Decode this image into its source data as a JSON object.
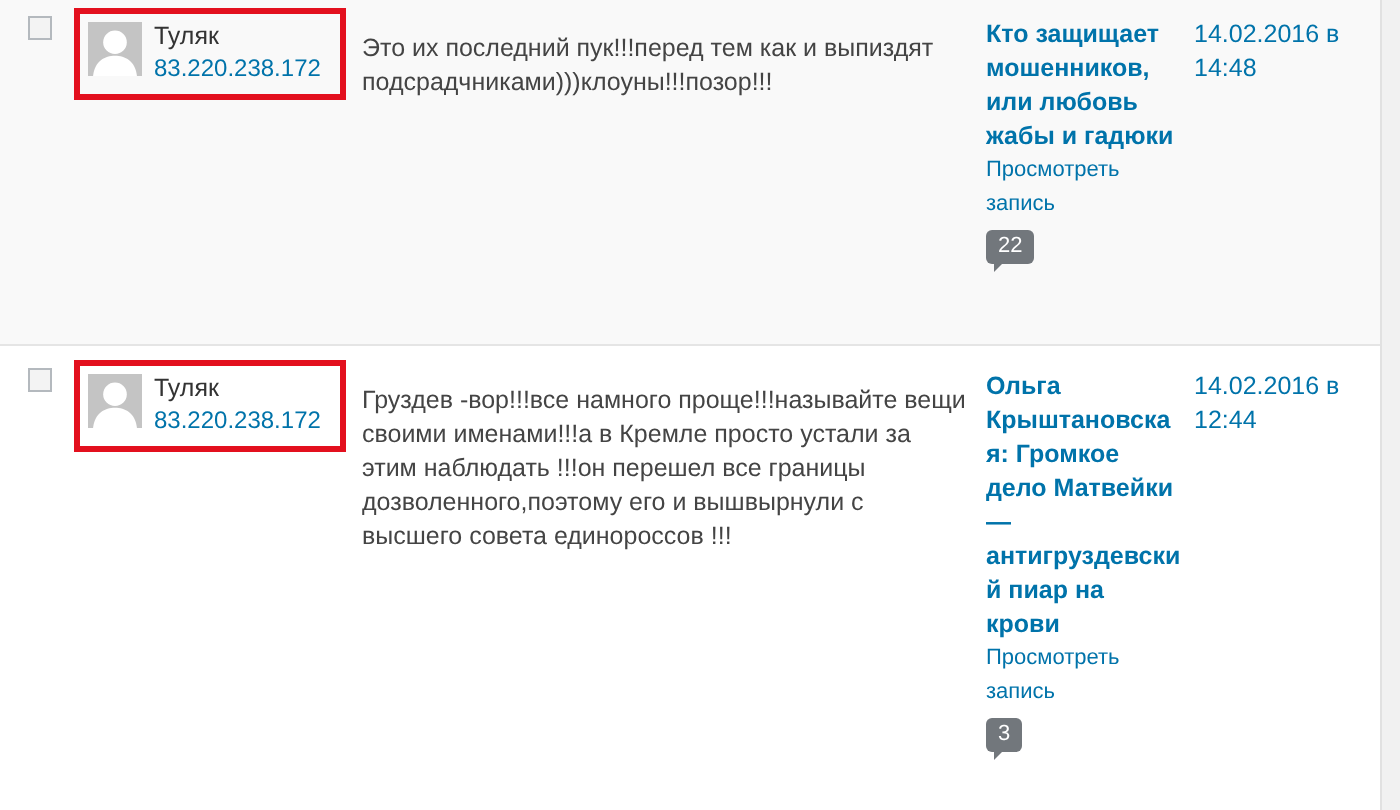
{
  "comments": [
    {
      "shaded": true,
      "checked": false,
      "highlighted": true,
      "author": "Туляк",
      "ip": "83.220.238.172",
      "text": "Это их последний пук!!!перед тем как и выпиздят подсрадчниками)))клоуны!!!позор!!!",
      "post_title": "Кто защищает мошенников, или любовь жабы и гадюки",
      "view_link": "Просмотреть запись",
      "count": "22",
      "date": "14.02.2016 в 14:48"
    },
    {
      "shaded": false,
      "checked": false,
      "highlighted": true,
      "author": "Туляк",
      "ip": "83.220.238.172",
      "text": "Груздев -вор!!!все намного проще!!!называйте вещи своими именами!!!а в Кремле просто устали за этим наблюдать !!!он перешел все границы дозволенного,поэтому его и вышвырнули с высшего совета единороссов !!!",
      "post_title": "Ольга Крыштановская: Громкое дело Матвейки — антигруздевский пиар на крови",
      "view_link": "Просмотреть запись",
      "count": "3",
      "date": "14.02.2016 в 12:44"
    }
  ]
}
